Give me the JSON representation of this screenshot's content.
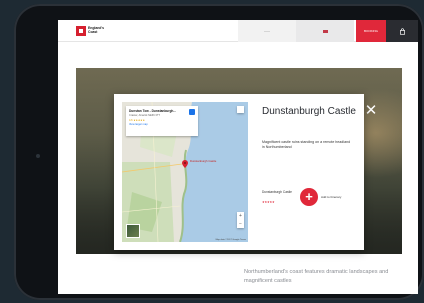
{
  "topbar": {
    "logo_text": "England's Coast",
    "nav_1": "——",
    "nav_red": "BOOKING",
    "bag_icon": "shopping-bag-icon"
  },
  "modal": {
    "title": "Dunstanburgh Castle",
    "description": "Magnificent castle ruins standing on a remote headland in Northumberland",
    "place": "Dunstanburgh Castle",
    "rating": "★★★★★",
    "add_label": "Add to Itinerary",
    "add_symbol": "+",
    "close_symbol": "✕"
  },
  "map": {
    "card_title": "Dunstan Tow - Dunstanburgh...",
    "card_addr": "Craster, Alnwick NE66 3TT",
    "card_rating": "4.6 ★★★★★",
    "card_link": "View larger map",
    "pin_label": "Dunstanburgh Castle",
    "zoom_in": "+",
    "zoom_out": "−",
    "footer": "Map data ©2017 Google  Terms"
  },
  "page": {
    "tagline": "Northumberland's coast features dramatic landscapes and magnificent castles"
  },
  "colors": {
    "accent": "#e0283a",
    "dark": "#2a2c31",
    "frame": "#0f1216"
  }
}
